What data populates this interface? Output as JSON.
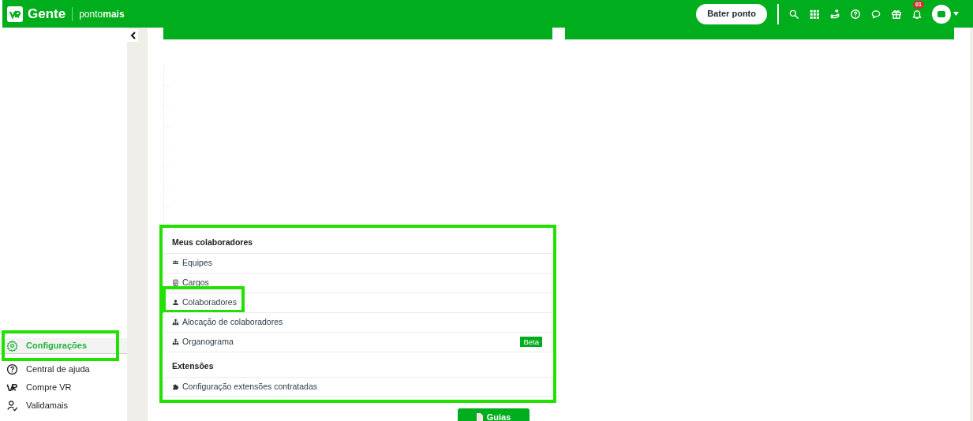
{
  "header": {
    "app_name": "Gente",
    "brand_light": "ponto",
    "brand_bold": "mais",
    "punch_button": "Bater ponto",
    "notification_count": "01"
  },
  "sidebar": {
    "items": [
      {
        "label": "Configurações",
        "selected": true,
        "highlighted": true
      },
      {
        "label": "Central de ajuda",
        "selected": false,
        "highlighted": false
      },
      {
        "label": "Compre VR",
        "selected": false,
        "highlighted": false
      },
      {
        "label": "Validamais",
        "selected": false,
        "highlighted": false
      }
    ]
  },
  "menu_card": {
    "highlighted": true,
    "sections": [
      {
        "title": "Meus colaboradores",
        "items": [
          {
            "label": "Equipes",
            "highlighted": false
          },
          {
            "label": "Cargos",
            "highlighted": false
          },
          {
            "label": "Colaboradores",
            "highlighted": true
          },
          {
            "label": "Alocação de colaboradores",
            "highlighted": false
          },
          {
            "label": "Organograma",
            "highlighted": false,
            "badge": "Beta"
          }
        ]
      },
      {
        "title": "Extensões",
        "items": [
          {
            "label": "Configuração extensões contratadas",
            "highlighted": false
          }
        ]
      }
    ]
  },
  "guides_button": "Guias"
}
